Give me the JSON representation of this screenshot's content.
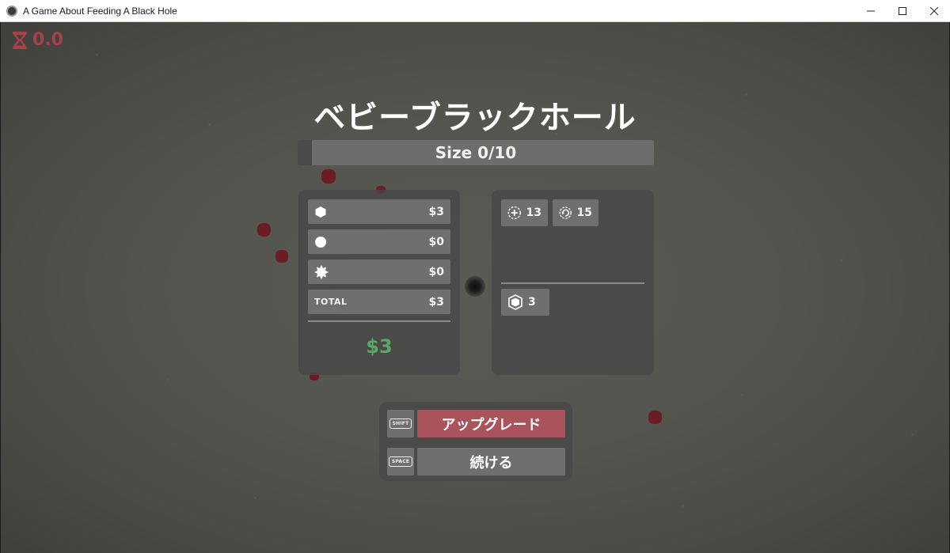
{
  "window": {
    "title": "A Game About Feeding A Black Hole",
    "icon": "black-hole-app-icon",
    "controls": [
      "minimize",
      "maximize",
      "close"
    ]
  },
  "hud": {
    "timer_icon": "hourglass-icon",
    "timer_value": "0.0",
    "timer_color": "#a9414b"
  },
  "title": "ベビーブラックホール",
  "size_bar": {
    "label": "Size 0/10",
    "current": 0,
    "max": 10
  },
  "earnings": {
    "rows": [
      {
        "icon": "hexagon-icon",
        "value": "$3"
      },
      {
        "icon": "circle-icon",
        "value": "$0"
      },
      {
        "icon": "starburst-icon",
        "value": "$0"
      }
    ],
    "total_label": "TOTAL",
    "total_value": "$3",
    "balance": "$3",
    "balance_color": "#5aa865"
  },
  "stats": {
    "top": [
      {
        "icon": "dashed-plus-circle-icon",
        "value": "13"
      },
      {
        "icon": "dashed-rotate-circle-icon",
        "value": "15"
      }
    ],
    "bottom": [
      {
        "icon": "shield-hexagon-icon",
        "value": "3"
      }
    ]
  },
  "actions": {
    "upgrade": {
      "key": "SHIFT",
      "label": "アップグレード",
      "color": "#a9545c"
    },
    "continue": {
      "key": "SPACE",
      "label": "続ける"
    }
  }
}
